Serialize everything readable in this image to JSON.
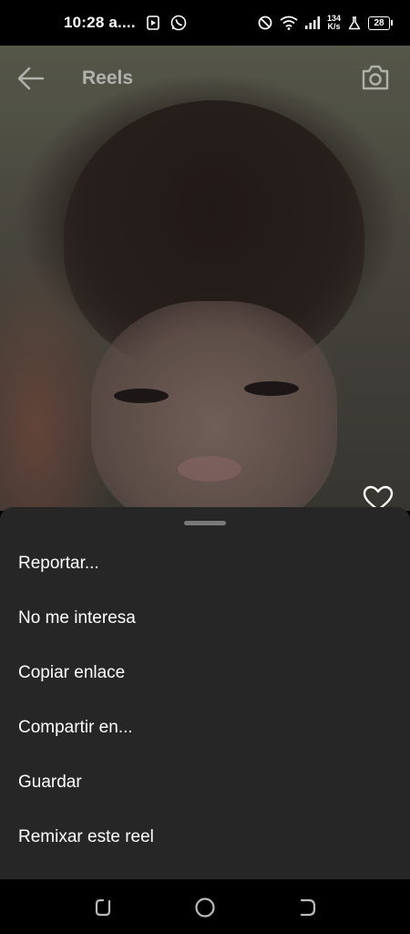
{
  "status_bar": {
    "time": "10:28 a....",
    "net_speed_value": "134",
    "net_speed_unit": "K/s",
    "battery": "28",
    "icons": [
      "media-play-icon",
      "whatsapp-icon",
      "do-not-disturb-icon",
      "wifi-icon",
      "signal-icon",
      "lab-icon",
      "battery-icon"
    ]
  },
  "header": {
    "title": "Reels",
    "back_icon": "arrow-left-icon",
    "camera_icon": "camera-icon"
  },
  "video": {
    "like_icon": "heart-outline-icon"
  },
  "sheet": {
    "items": [
      {
        "label": "Reportar..."
      },
      {
        "label": "No me interesa"
      },
      {
        "label": "Copiar enlace"
      },
      {
        "label": "Compartir en..."
      },
      {
        "label": "Guardar"
      },
      {
        "label": "Remixar este reel"
      }
    ]
  },
  "nav_bar": {
    "icons": [
      "recent-apps-icon",
      "home-icon",
      "back-icon"
    ]
  },
  "colors": {
    "sheet_background": "#262626",
    "background": "#000000",
    "text": "#ffffff"
  }
}
